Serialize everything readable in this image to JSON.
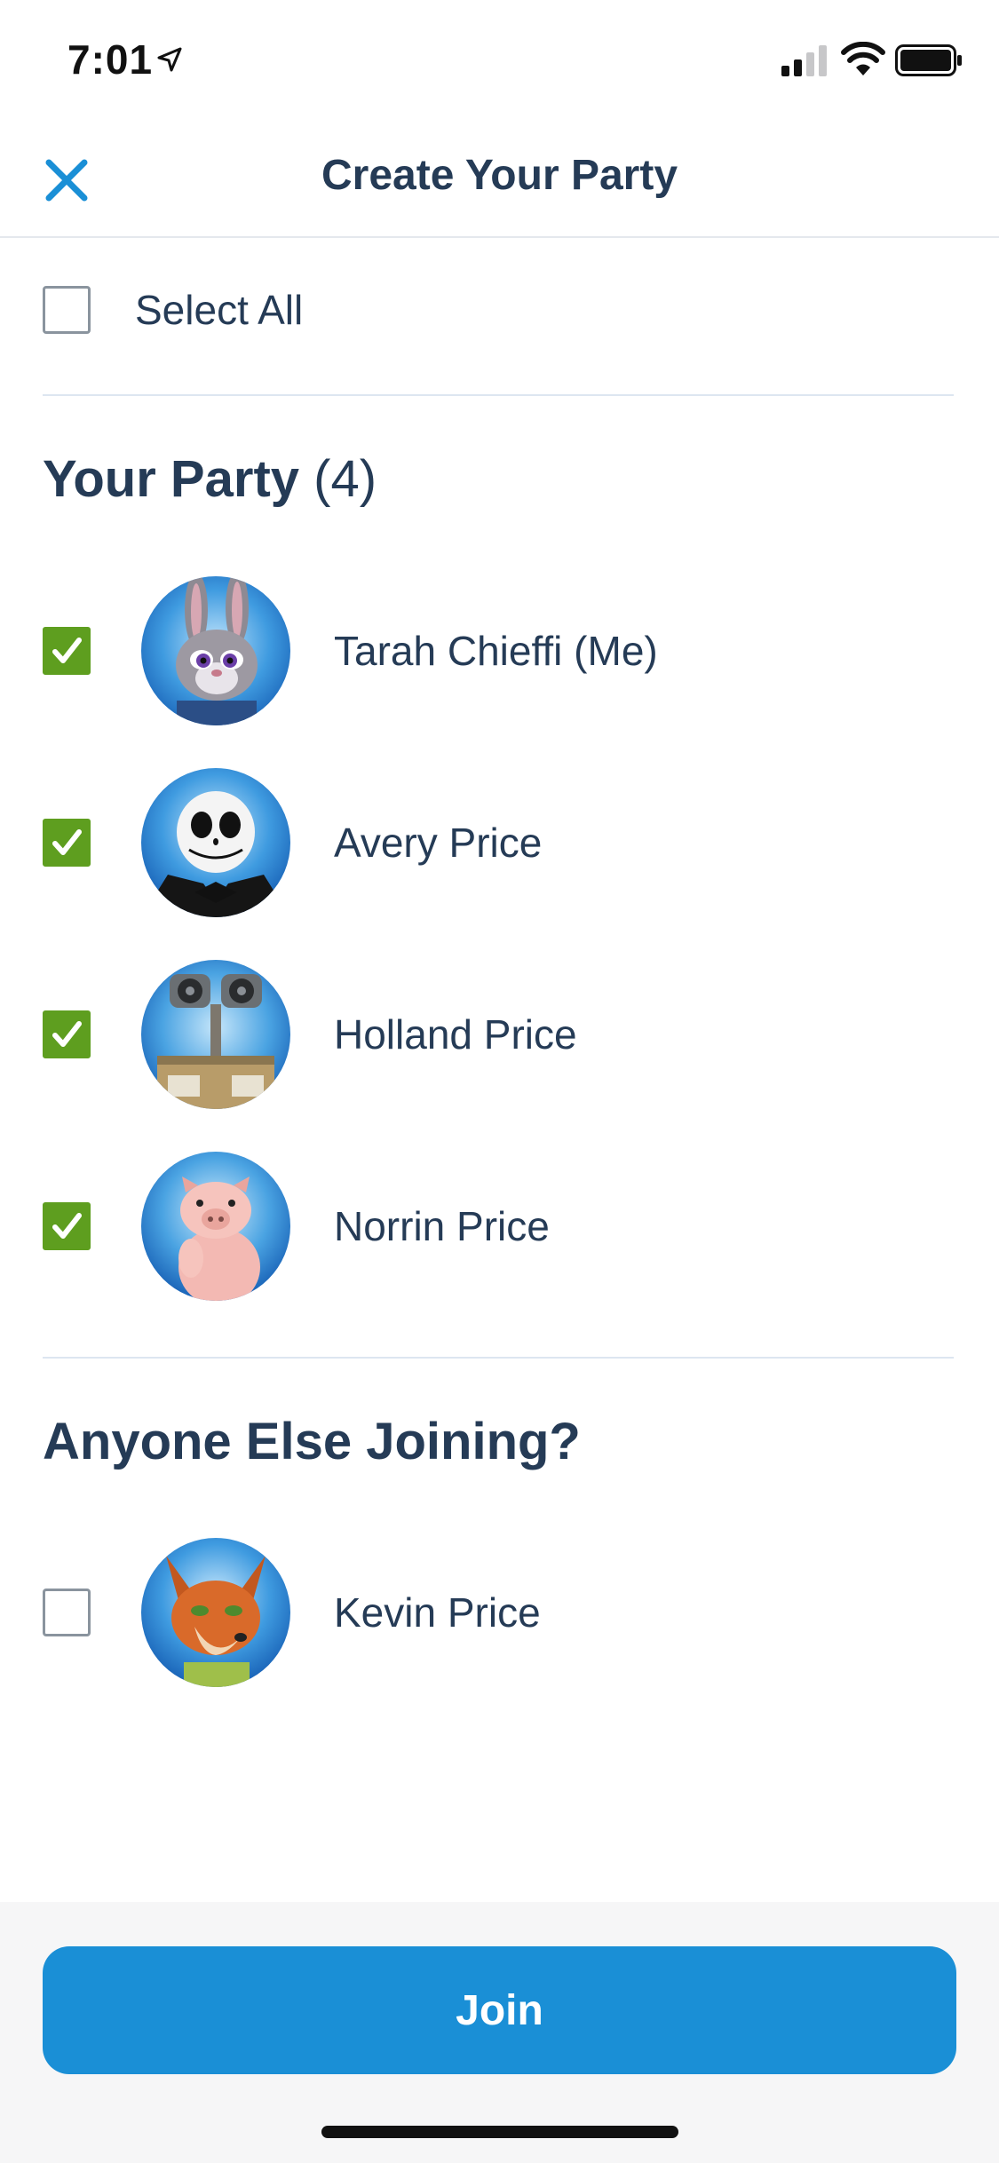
{
  "status_bar": {
    "time": "7:01"
  },
  "header": {
    "title": "Create Your Party"
  },
  "select_all": {
    "label": "Select All",
    "checked": false
  },
  "party": {
    "title": "Your Party",
    "count": "(4)",
    "members": [
      {
        "name": "Tarah Chieffi (Me)",
        "checked": true,
        "avatar": "judy-hopps-avatar"
      },
      {
        "name": "Avery Price",
        "checked": true,
        "avatar": "jack-skellington-avatar"
      },
      {
        "name": "Holland Price",
        "checked": true,
        "avatar": "wall-e-avatar"
      },
      {
        "name": "Norrin Price",
        "checked": true,
        "avatar": "hamm-pig-avatar"
      }
    ]
  },
  "others": {
    "title": "Anyone Else Joining?",
    "members": [
      {
        "name": "Kevin Price",
        "checked": false,
        "avatar": "nick-wilde-avatar"
      }
    ]
  },
  "footer": {
    "join_label": "Join"
  },
  "colors": {
    "accent_blue": "#1a8fd6",
    "check_green": "#5e9e1f",
    "text_navy": "#253b56"
  }
}
